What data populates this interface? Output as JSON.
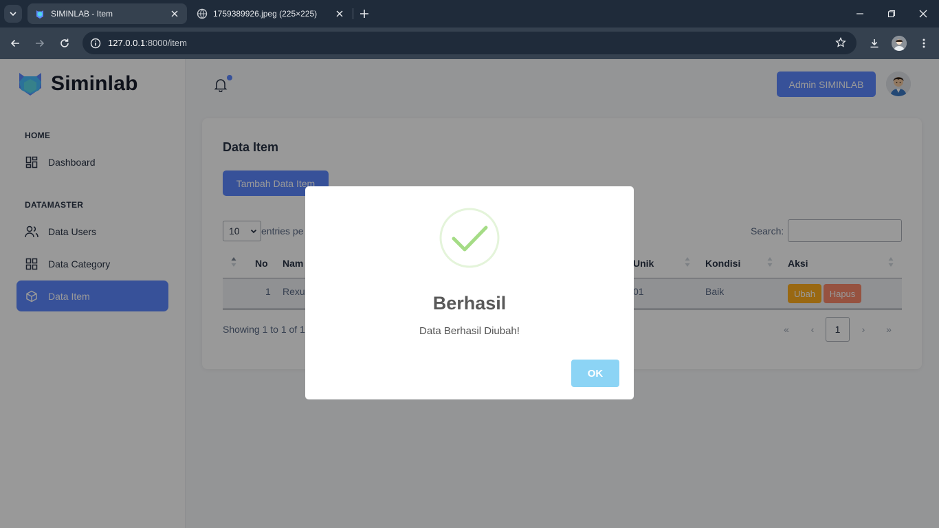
{
  "browser": {
    "tabs": [
      {
        "title": "SIMINLAB - Item",
        "active": true,
        "icon": "siminlab-favicon"
      },
      {
        "title": "1759389926.jpeg (225×225)",
        "active": false,
        "icon": "globe-icon"
      }
    ],
    "url_host": "127.0.0.1",
    "url_path": ":8000/item"
  },
  "sidebar": {
    "brand": "Siminlab",
    "sections": [
      {
        "label": "HOME",
        "items": [
          {
            "label": "Dashboard",
            "icon": "dashboard-icon"
          }
        ]
      },
      {
        "label": "DATAMASTER",
        "items": [
          {
            "label": "Data Users",
            "icon": "users-icon"
          },
          {
            "label": "Data Category",
            "icon": "category-icon"
          },
          {
            "label": "Data Item",
            "icon": "cube-icon",
            "active": true
          }
        ]
      }
    ]
  },
  "header": {
    "admin_label": "Admin SIMINLAB"
  },
  "card": {
    "title": "Data Item",
    "add_label": "Tambah Data Item",
    "length_value": "10",
    "length_label": "entries pe",
    "search_label": "Search:",
    "columns": [
      "No",
      "Nam",
      "Unik",
      "Kondisi",
      "Aksi"
    ],
    "row": {
      "no": "1",
      "nama": "Rexu",
      "unik": "01",
      "kondisi": "Baik"
    },
    "edit_label": "Ubah",
    "delete_label": "Hapus",
    "info": "Showing 1 to 1 of 1 e",
    "pagination": {
      "first": "«",
      "prev": "‹",
      "current": "1",
      "next": "›",
      "last": "»"
    }
  },
  "modal": {
    "title": "Berhasil",
    "text": "Data Berhasil Diubah!",
    "ok_label": "OK",
    "icon": "success-check-icon"
  },
  "colors": {
    "primary": "#5d87ff",
    "warning": "#ffae1f",
    "danger": "#fa896b",
    "success": "#a5dc86",
    "ok_button": "#8cd4f5"
  }
}
